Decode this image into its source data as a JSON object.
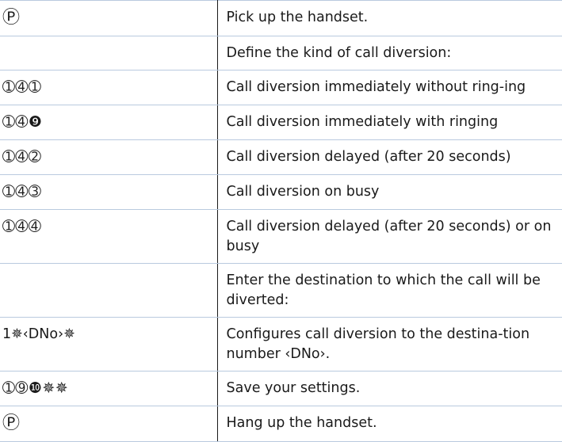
{
  "rows": [
    {
      "keys": "Ⓟ",
      "description": "Pick up the handset.",
      "kind": "phone-icon"
    },
    {
      "keys": "",
      "description": "Define the kind of call diversion:",
      "kind": "empty"
    },
    {
      "keys": "➀➃➀",
      "description": "Call diversion immediately without ring-ing",
      "kind": "keys"
    },
    {
      "keys": "➀➃❾",
      "description": "Call diversion immediately with ringing",
      "kind": "keys"
    },
    {
      "keys": "➀➃➁",
      "description": "Call diversion delayed (after 20 seconds)",
      "kind": "keys"
    },
    {
      "keys": "➀➃➂",
      "description": "Call diversion on busy",
      "kind": "keys"
    },
    {
      "keys": "➀➃➃",
      "description": "Call diversion delayed (after 20 seconds) or on busy",
      "kind": "keys"
    },
    {
      "keys": "",
      "description": "Enter the destination to which the call will be diverted:",
      "kind": "empty"
    },
    {
      "keys": "1✵‹DNo›✵",
      "description": "Configures call diversion to the destina-tion number ‹DNo›.",
      "kind": "text"
    },
    {
      "keys": "➀➈❿✵✵",
      "description": "Save your settings.",
      "kind": "keys"
    },
    {
      "keys": "Ⓟ",
      "description": "Hang up the handset.",
      "kind": "phone-icon"
    }
  ],
  "colors": {
    "row_divider": "#b9cadf",
    "column_divider": "#1a1a1a",
    "text": "#1a1a1a"
  }
}
